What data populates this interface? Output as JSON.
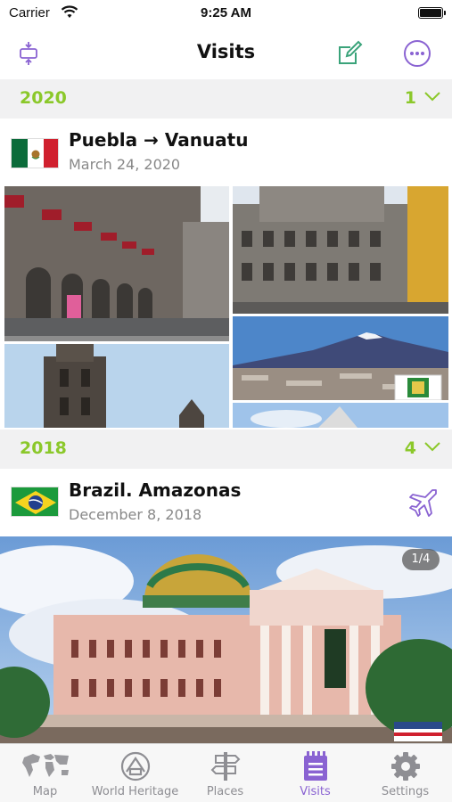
{
  "status_bar": {
    "carrier": "Carrier",
    "time": "9:25 AM"
  },
  "header": {
    "title": "Visits"
  },
  "sections": [
    {
      "year": "2020",
      "count": "1",
      "visit": {
        "title": "Puebla → Vanuatu",
        "date": "March 24, 2020"
      }
    },
    {
      "year": "2018",
      "count": "4",
      "visit": {
        "title": "Brazil. Amazonas",
        "date": "December 8, 2018",
        "photo_counter": "1/4"
      }
    }
  ],
  "tabs": [
    {
      "label": "Map",
      "icon": "world-map-icon",
      "active": false
    },
    {
      "label": "World Heritage",
      "icon": "world-heritage-icon",
      "active": false
    },
    {
      "label": "Places",
      "icon": "signpost-icon",
      "active": false
    },
    {
      "label": "Visits",
      "icon": "notebook-icon",
      "active": true
    },
    {
      "label": "Settings",
      "icon": "gear-icon",
      "active": false
    }
  ],
  "colors": {
    "accent": "#8a63d2",
    "year_green": "#8bc82a",
    "compose_green": "#3aa37a"
  }
}
